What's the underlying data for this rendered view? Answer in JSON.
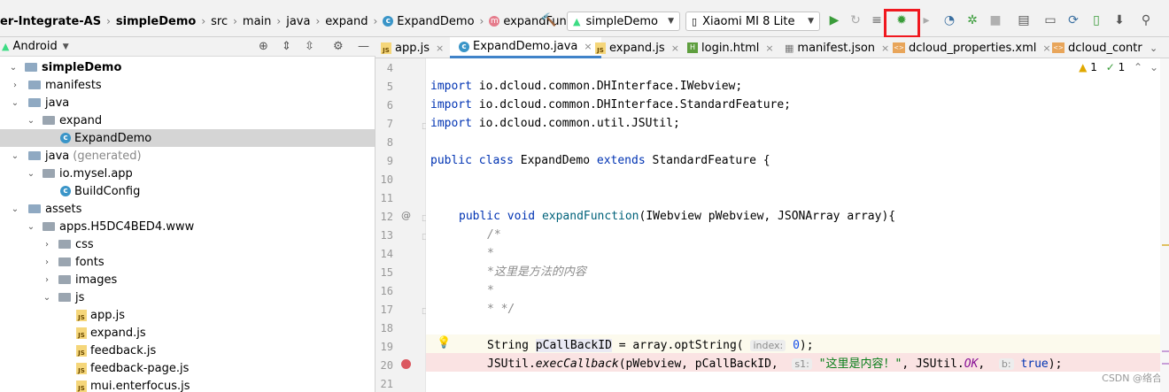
{
  "breadcrumbs": {
    "project_partial": "er-Integrate-AS",
    "module": "simpleDemo",
    "src": "src",
    "main": "main",
    "java": "java",
    "expand": "expand",
    "class": "ExpandDemo",
    "method": "expandFunction"
  },
  "toolbar": {
    "config": "simpleDemo",
    "device": "Xiaomi MI 8 Lite"
  },
  "project_panel": {
    "view": "Android",
    "tree": [
      {
        "label": "simpleDemo",
        "depth": 0,
        "bold": true,
        "expanded": true
      },
      {
        "label": "manifests",
        "depth": 1,
        "expanded": false
      },
      {
        "label": "java",
        "depth": 1,
        "expanded": true
      },
      {
        "label": "expand",
        "depth": 2,
        "expanded": true
      },
      {
        "label": "ExpandDemo",
        "depth": 3,
        "selected": true
      },
      {
        "label": "java",
        "suffix": "(generated)",
        "depth": 1,
        "expanded": true
      },
      {
        "label": "io.mysel.app",
        "depth": 2,
        "expanded": true
      },
      {
        "label": "BuildConfig",
        "depth": 3
      },
      {
        "label": "assets",
        "depth": 1,
        "expanded": true
      },
      {
        "label": "apps.H5DC4BED4.www",
        "depth": 2,
        "expanded": true
      },
      {
        "label": "css",
        "depth": 3,
        "expanded": false
      },
      {
        "label": "fonts",
        "depth": 3,
        "expanded": false
      },
      {
        "label": "images",
        "depth": 3,
        "expanded": false
      },
      {
        "label": "js",
        "depth": 3,
        "expanded": true
      },
      {
        "label": "app.js",
        "depth": 4
      },
      {
        "label": "expand.js",
        "depth": 4
      },
      {
        "label": "feedback.js",
        "depth": 4
      },
      {
        "label": "feedback-page.js",
        "depth": 4
      },
      {
        "label": "mui.enterfocus.js",
        "depth": 4
      }
    ]
  },
  "tabs": [
    {
      "label": "app.js"
    },
    {
      "label": "ExpandDemo.java",
      "active": true
    },
    {
      "label": "expand.js"
    },
    {
      "label": "login.html"
    },
    {
      "label": "manifest.json"
    },
    {
      "label": "dcloud_properties.xml"
    },
    {
      "label": "dcloud_contr"
    }
  ],
  "inspections": {
    "warnings": "1",
    "ok": "1"
  },
  "editor": {
    "line_numbers": [
      "4",
      "5",
      "6",
      "7",
      "8",
      "9",
      "10",
      "11",
      "12",
      "13",
      "14",
      "15",
      "16",
      "17",
      "18",
      "19",
      "20",
      "21"
    ],
    "import1": "io.dcloud.common.DHInterface.IWebview;",
    "import2": "io.dcloud.common.DHInterface.StandardFeature;",
    "import3": "io.dcloud.common.util.JSUtil;",
    "kw_import": "import",
    "kw_public": "public",
    "kw_class": "class",
    "kw_extends": "extends",
    "kw_void": "void",
    "class_name": "ExpandDemo",
    "super_name": "StandardFeature",
    "method_name": "expandFunction",
    "params": "(IWebview pWebview, JSONArray array){",
    "brace": "{",
    "c1": "/*",
    "c2": "*",
    "c3": "*这里是方法的内容",
    "c4": "*",
    "c5": "* */",
    "l19_type": "String ",
    "l19_var": "pCallBackID",
    "l19_mid": " = array.optString(",
    "l19_hint": "index:",
    "l19_num": "0",
    "l19_end": ");",
    "l20_a": "JSUtil.",
    "l20_m": "execCallback",
    "l20_b": "(pWebview, pCallBackID, ",
    "l20_hint1": "s1:",
    "l20_str": "\"这里是内容！\"",
    "l20_c": ", JSUtil.",
    "l20_ok": "OK",
    "l20_d": ", ",
    "l20_hint2": "b:",
    "l20_true": "true",
    "l20_e": ");"
  },
  "watermark": "CSDN @络合"
}
